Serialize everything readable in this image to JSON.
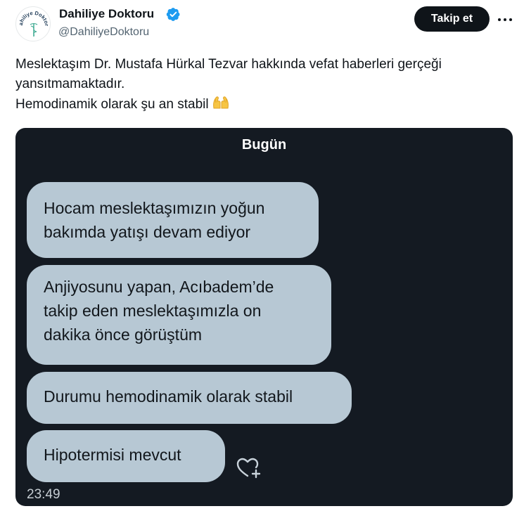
{
  "header": {
    "display_name": "Dahiliye Doktoru",
    "handle": "@DahiliyeDoktoru",
    "avatar_text": "Dahiliye Doktoru",
    "follow_label": "Takip et",
    "more_icon": "more-dots-icon",
    "verified_icon": "verified-badge-icon"
  },
  "tweet": {
    "lines": [
      "Meslektaşım Dr. Mustafa Hürkal Tezvar hakkında vefat haberleri gerçeği",
      "yansıtmamaktadır.",
      "Hemodinamik olarak şu an stabil"
    ],
    "emoji": "praying-hands-emoji"
  },
  "screenshot": {
    "day_label": "Bugün",
    "messages": [
      {
        "lines": [
          "Hocam meslektaşımızın yoğun",
          "bakımda yatışı devam ediyor"
        ]
      },
      {
        "lines": [
          "Anjiyosunu yapan, Acıbadem’de",
          "takip eden meslektaşımızla on",
          "dakika önce görüştüm"
        ]
      },
      {
        "lines": [
          "Durumu hemodinamik olarak stabil"
        ]
      },
      {
        "lines": [
          "Hipotermisi mevcut"
        ]
      }
    ],
    "time": "23:49",
    "reaction_icon": "heart-add-icon"
  },
  "colors": {
    "follow_bg": "#0f1419",
    "verified": "#1d9bf0",
    "card_bg": "#141a22",
    "bubble_bg": "#b7c8d4",
    "handle_text": "#536471"
  }
}
